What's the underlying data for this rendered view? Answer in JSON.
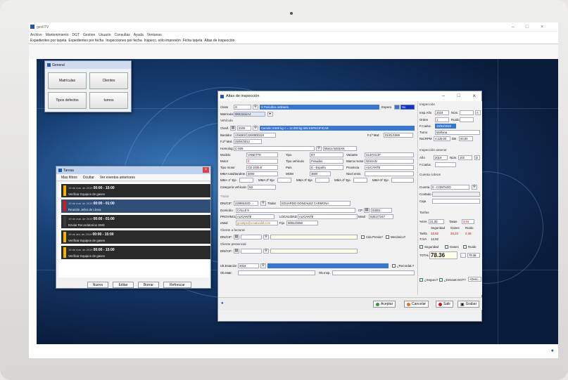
{
  "app": {
    "title": "gestITV"
  },
  "menu": [
    "Archivo",
    "Mantenimiento",
    "DGT",
    "Gestion",
    "Usuario",
    "Consultas",
    "Ayuda",
    "Ventanas"
  ],
  "toolbar": [
    "Expedientes por tarjeta",
    "Expedientes por fecha",
    "Inspecciones por fecha",
    "Inspecc. sólo impresión",
    "Ficha tarjeta",
    "Altas de inspección"
  ],
  "general": {
    "title": "General",
    "buttons": [
      "Matrículas",
      "Clientes",
      "Tipos defectos",
      "turnos"
    ]
  },
  "tareas": {
    "title": "Tareas",
    "tools": [
      "Mas filtros",
      "Ocultar",
      "Ver eventos anteriores"
    ],
    "items": [
      {
        "date": "19 de mar. de 2019",
        "time": "00:00 - 15:00",
        "text": "Verificar Equipos de gases",
        "color": "#f0b400"
      },
      {
        "date": "19 de mar. de 2019",
        "time": "00:00 - 01:00",
        "text": "Reunión Jefes de Línea",
        "color": "#d81818"
      },
      {
        "date": "19 de mar. de 2019",
        "time": "00:00 - 01:00",
        "text": "Enviar Recordatorios SMS",
        "color": "#3a3a3a"
      },
      {
        "date": "19 de abr. de 2019",
        "time": "00:00 - 15:00",
        "text": "Verificar Equipos de gases",
        "color": "#f0b400"
      },
      {
        "date": "19 de mar. de 2019",
        "time": "00:00 - 15:00",
        "text": "Verificar Equipos de gases",
        "color": "#f0b400"
      }
    ],
    "buttons": [
      "Nuevo",
      "Editar",
      "Borrar",
      "Refrescar"
    ]
  },
  "altas": {
    "title": "Altas de inspección",
    "clase_label": "Clase",
    "clase_code": "S",
    "clase_value": "S Periodica ordinaria",
    "espera_label": "Espera",
    "espera_value": "No",
    "matricula_label": "Matricula:",
    "matricula_value": "9MU1111AJ",
    "vehiculo_label": "Vehículo",
    "clasif_label": "Clasif.",
    "clasif_code": "2100",
    "clasif_value": "Camión 3.500 kg < = 12.000 kg SIN ESPECIFICAR",
    "bastidor_label": "Bastidor",
    "bastidor_value": "VSKBGC22000D0119",
    "f1mat_label": "F.1ª Mat:",
    "f1mat_value": "01/01/1999",
    "f2mat_label": "F.2ª Mat:",
    "f2mat_value": "29/04/2012",
    "homolog_label": "Homolog.",
    "homolog_value": "C-505",
    "marca_nissan": "Marca NISSAN",
    "modelo_label": "Modelo",
    "modelo_value": "VANETTE",
    "tipo_label": "Tipo",
    "tipo_value": "RT",
    "variante_label": "Variante",
    "variante_value": "S14FX1/JF",
    "motor_label": "Motor",
    "motor_value": "0",
    "tipoveh_label": "Tipo vehículo",
    "tipoveh_value": "Pesados",
    "marcamotor_label": "Marca motor",
    "marcamotor_value": "NISSAN",
    "tipomotor_label": "Tipo motor",
    "tipomotor_value": "CD 1035 E",
    "pais_label": "Pais",
    "pais_value": "E - España",
    "provincia_label": "Provincia",
    "provincia_value": "ALICANTE",
    "mma_label": "MMA total/tandem",
    "mma_value": "4000",
    "mom_label": "MOM",
    "mom_value": "3500",
    "nivel_label": "Nivel emis.",
    "ejes_labels": [
      "MMA 1º Eje",
      "MMA 2º Eje",
      "MMA 3º Eje",
      "MMA 4º Eje",
      "MMA 5º Eje"
    ],
    "categoria_label": "Categoría vehículo",
    "categoria_value": "N2",
    "titular_section": "Titular",
    "dni_label": "DNI/CIF:",
    "dni_value": "22999102D",
    "titular_label": "Titular",
    "titular_value": "EDUARDO GONZALEZ CARMONA",
    "domicilio_label": "Domicilio",
    "domicilio_value": "CALLE 9",
    "cp_label": "CP",
    "cp_value": "03001",
    "provincia2_label": "PROVINCIA",
    "provincia2_value": "ALICANTE",
    "localidad_label": "LOCALIDAD",
    "localidad_value": "ALICANTE",
    "movil_label": "Movil",
    "movil_value": "636177247",
    "email_label": "eMail",
    "email_value": "gmaitpe@creativalid.com",
    "fijo_label": "Fijo",
    "fijo_value": "968123456",
    "facturar_section": "Cliente a facturar",
    "cita_previa": "Cita Previa?",
    "mecanico": "Mecánico?",
    "presencial_section": "Cliente presencial",
    "dnicif2_label": "DNI/CIF:",
    "ultestacion_label": "Ult.Estación",
    "ultestacion_value": "3018",
    "recordat": "¿Recordat.?",
    "obmatr_label": "Ob.Matr.",
    "obinsp_label": "Ob.Insp.",
    "inspeccion_section": "Inspección",
    "inspano_label": "Insp.Año",
    "inspano_value": "2019",
    "num_label": "Núm.",
    "num_letter": "A",
    "orden_label": "Orden",
    "orden_value": "1",
    "ruido_label": "Ruido",
    "fcaduc_label": "F.Caduc.",
    "fcaduc_value": "19/03/2020",
    "turno_label": "Turno",
    "turno_value": "Mañana",
    "ralrpm_label": "Ral.RPM",
    "ralrpm_value": "4.125,00",
    "db_label": "DB",
    "db_value": "93,00",
    "anterior_section": "Inspección anterior",
    "ano_label": "Año",
    "ano_value": "2019",
    "num2_label": "Núm.",
    "num2_value": "102",
    "num2_letter": "D",
    "fcaduc2_label": "F.Caduc.",
    "cobros_section": "Cuenta cobros",
    "cuenta_label": "Cuenta",
    "cuenta_value": "0 - CONTADO",
    "contado_label": "Contado",
    "caja_label": "Caja",
    "tarifas_section": "Tarifas",
    "iva_label": "%IVA",
    "iva_value": "21,00",
    "tasas_label": "Tasas",
    "tasas_value": "3,64",
    "col_labels": [
      "Seguridad",
      "Gases",
      "Ruido"
    ],
    "tarifa_label": "Tarifa",
    "tarifa_values": [
      "32,82",
      "26,24",
      "2,48"
    ],
    "tiva_label": "T.IVA",
    "tiva_value": "12,92",
    "check_labels": [
      "Seguridad",
      "Gases",
      "Ruido"
    ],
    "total_label": "TOTAL",
    "total_value": "78.36",
    "total_small": "78.36",
    "seguro_label": "¿Seguro?",
    "deseadgt_label": "¿Desea€ DGT?",
    "desc_label": "+Desc...",
    "buttons": [
      "Aceptar",
      "Cancelar",
      "Salir",
      "Grabar"
    ]
  },
  "colors": {
    "accent": "#3777d3",
    "desktop": "#173f74"
  }
}
